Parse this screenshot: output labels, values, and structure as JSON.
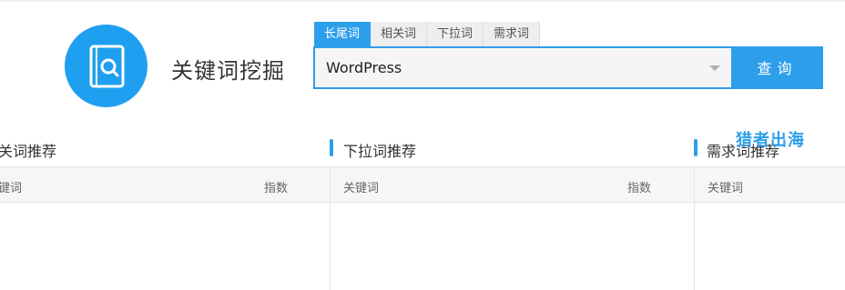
{
  "tool": {
    "title": "关键词挖掘",
    "icon": "book-search-icon"
  },
  "tabs": [
    {
      "label": "长尾词",
      "active": true
    },
    {
      "label": "相关词",
      "active": false
    },
    {
      "label": "下拉词",
      "active": false
    },
    {
      "label": "需求词",
      "active": false
    }
  ],
  "search": {
    "value": "WordPress",
    "button_label": "查询"
  },
  "sections": [
    {
      "title": "关词推荐",
      "col_keyword": "键词",
      "col_index": "指数"
    },
    {
      "title": "下拉词推荐",
      "col_keyword": "关键词",
      "col_index": "指数"
    },
    {
      "title": "需求词推荐",
      "col_keyword": "关键词"
    }
  ],
  "watermark": "猎者出海",
  "colors": {
    "accent": "#2d9ee9",
    "logo": "#1f9ff0"
  }
}
